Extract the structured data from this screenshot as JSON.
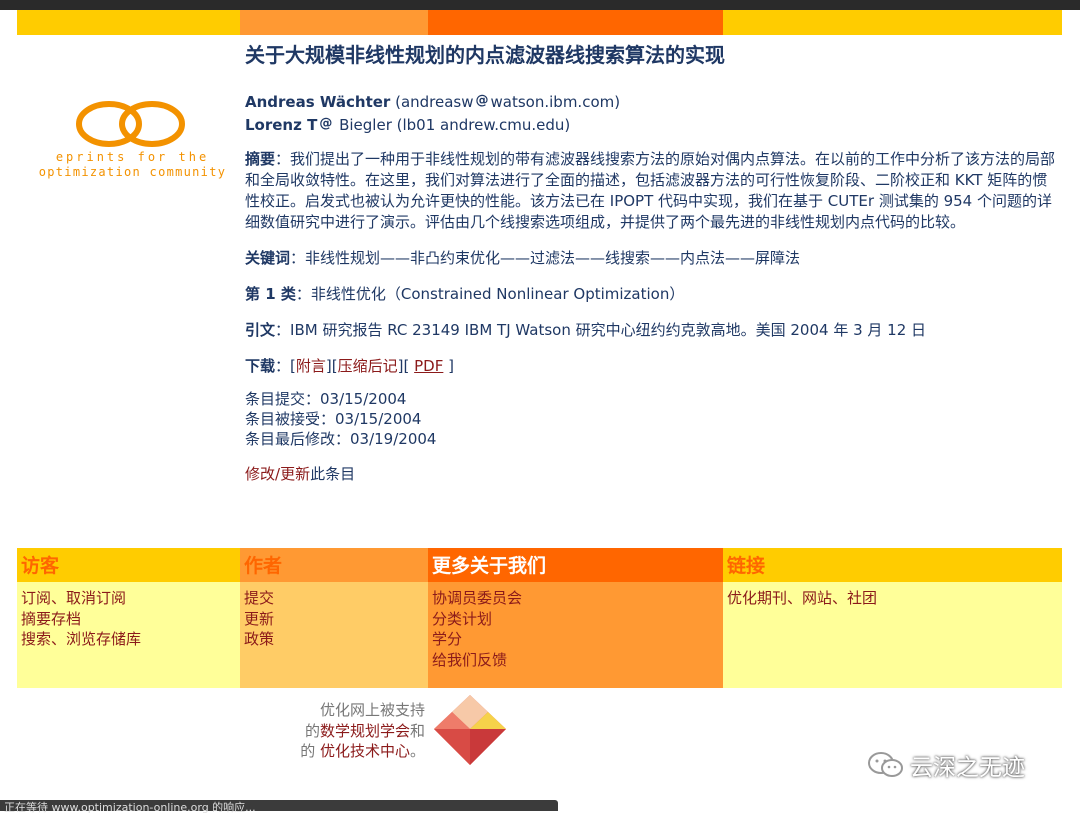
{
  "header": {
    "title": "关于大规模非线性规划的内点滤波器线搜索算法的实现"
  },
  "authors": [
    {
      "name": "Andreas Wächter",
      "email_user": "(andreasw",
      "email_domain": "watson.ibm.com)"
    },
    {
      "name": "Lorenz T",
      "email_user": "Biegler (lb01",
      "email_domain": "andrew.cmu.edu)"
    }
  ],
  "logo": {
    "line1": "eprints for the",
    "line2": "optimization community"
  },
  "abstract": {
    "label": "摘要",
    "text": "：我们提出了一种用于非线性规划的带有滤波器线搜索方法的原始对偶内点算法。在以前的工作中分析了该方法的局部和全局收敛特性。在这里，我们对算法进行了全面的描述，包括滤波器方法的可行性恢复阶段、二阶校正和 KKT 矩阵的惯性校正。启发式也被认为允许更快的性能。该方法已在 IPOPT 代码中实现，我们在基于 CUTEr 测试集的 954 个问题的详细数值研究中进行了演示。评估由几个线搜索选项组成，并提供了两个最先进的非线性规划内点代码的比较。"
  },
  "keywords": {
    "label": "关键词",
    "text": "：非线性规划——非凸约束优化——过滤法——线搜索——内点法——屏障法"
  },
  "category": {
    "label": "第 1 类",
    "text": "：非线性优化（Constrained Nonlinear Optimization）"
  },
  "citation": {
    "label": "引文",
    "text": "：IBM 研究报告 RC 23149 IBM TJ Watson 研究中心纽约约克敦高地。美国 2004 年 3 月 12 日"
  },
  "download": {
    "label": "下载",
    "colon": "：",
    "links": [
      "附言",
      "压缩后记",
      "PDF"
    ]
  },
  "dates": {
    "submitted": "条目提交：03/15/2004",
    "accepted": "条目被接受：03/15/2004",
    "modified": "条目最后修改：03/19/2004"
  },
  "modify": {
    "link1": "修改",
    "sep": "/",
    "link2": "更新",
    "tail": "此条目"
  },
  "footer": {
    "visitors": {
      "title": "访客",
      "items": [
        "订阅、取消订阅",
        "摘要存档",
        "搜索、浏览存储库"
      ]
    },
    "authors": {
      "title": "作者",
      "items": [
        "提交",
        "更新",
        "政策"
      ]
    },
    "about": {
      "title": "更多关于我们",
      "items": [
        "协调员委员会",
        "分类计划",
        "学分",
        "给我们反馈"
      ]
    },
    "links": {
      "title": "链接",
      "items": [
        "优化期刊、网站、社团"
      ]
    }
  },
  "support": {
    "line1": "优化网上被支持",
    "pre2": "的",
    "link2": "数学规划学会",
    "post2": "和",
    "pre3": "的 ",
    "link3": "优化技术中心",
    "post3": "。"
  },
  "watermark": "云深之无迹",
  "statusbar": "正在等待 www.optimization-online.org 的响应..."
}
